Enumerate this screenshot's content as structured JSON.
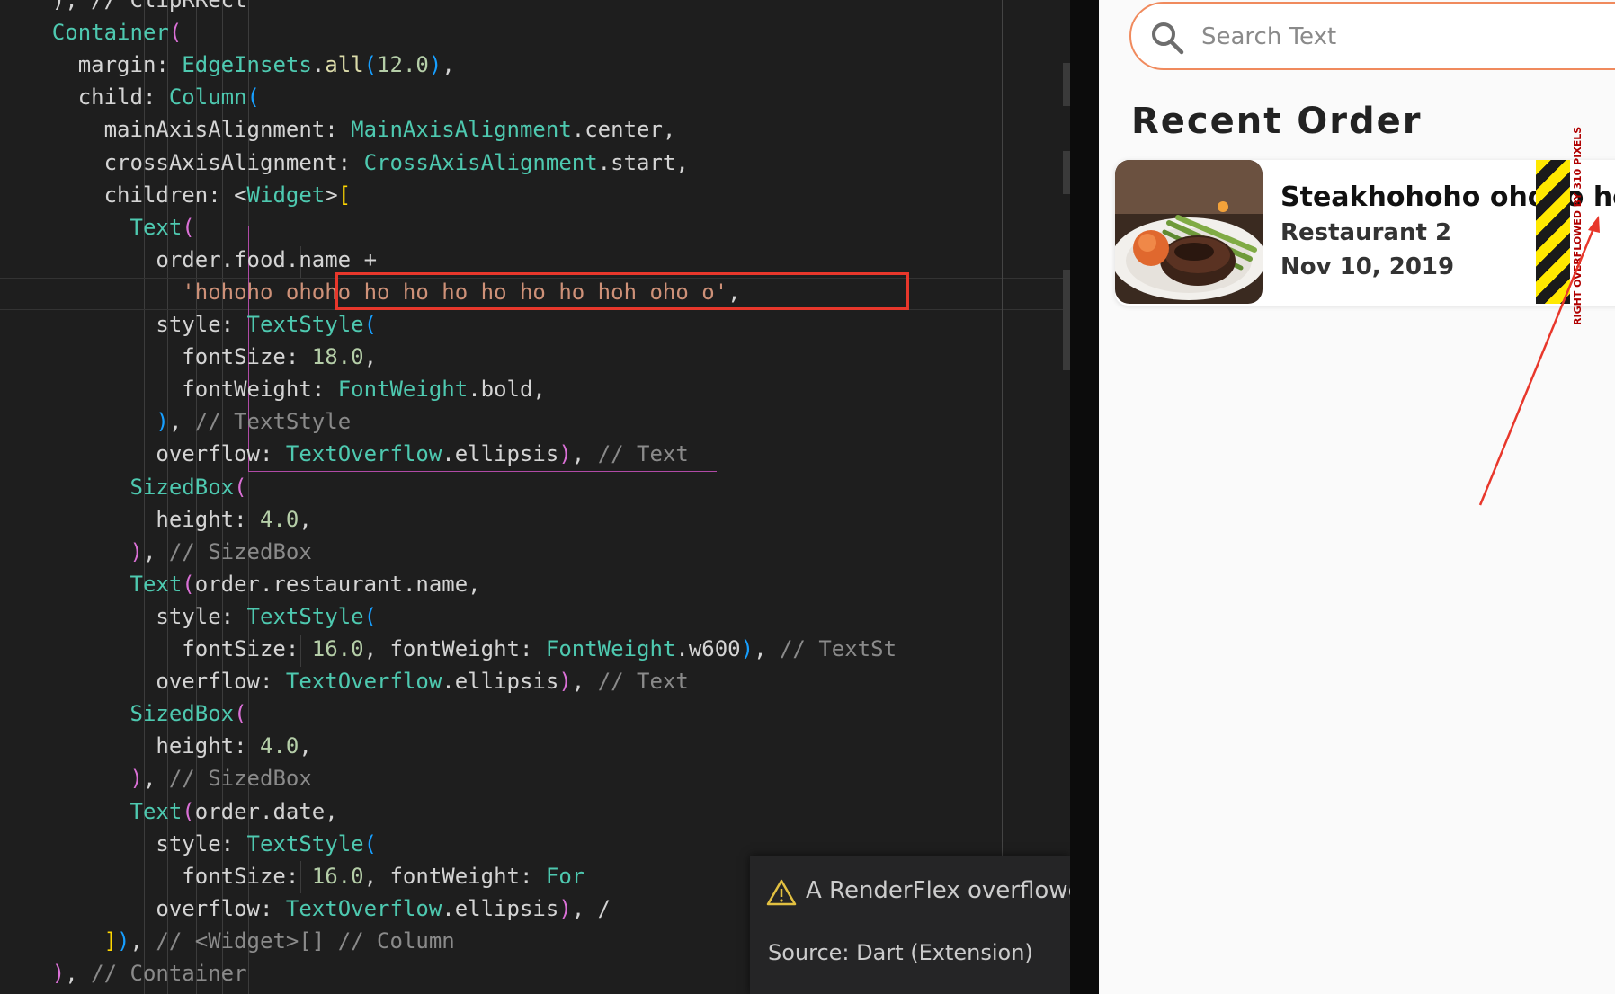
{
  "editor": {
    "lines": [
      [
        {
          "c": "tl",
          "t": "    ), // ClipRRect"
        }
      ],
      [
        {
          "c": "cl",
          "t": "    Container"
        },
        {
          "c": "p1",
          "t": "("
        }
      ],
      [
        {
          "c": "tl",
          "t": "      margin: "
        },
        {
          "c": "cl",
          "t": "EdgeInsets"
        },
        {
          "c": "tl",
          "t": "."
        },
        {
          "c": "fn",
          "t": "all"
        },
        {
          "c": "p3",
          "t": "("
        },
        {
          "c": "num",
          "t": "12.0"
        },
        {
          "c": "p3",
          "t": ")"
        },
        {
          "c": "tl",
          "t": ","
        }
      ],
      [
        {
          "c": "tl",
          "t": "      child: "
        },
        {
          "c": "cl",
          "t": "Column"
        },
        {
          "c": "p3",
          "t": "("
        }
      ],
      [
        {
          "c": "tl",
          "t": "        mainAxisAlignment: "
        },
        {
          "c": "cl",
          "t": "MainAxisAlignment"
        },
        {
          "c": "tl",
          "t": ".center,"
        }
      ],
      [
        {
          "c": "tl",
          "t": "        crossAxisAlignment: "
        },
        {
          "c": "cl",
          "t": "CrossAxisAlignment"
        },
        {
          "c": "tl",
          "t": ".start,"
        }
      ],
      [
        {
          "c": "tl",
          "t": "        children: <"
        },
        {
          "c": "cl",
          "t": "Widget"
        },
        {
          "c": "tl",
          "t": ">"
        },
        {
          "c": "p2",
          "t": "["
        }
      ],
      [
        {
          "c": "cl",
          "t": "          Text"
        },
        {
          "c": "p1",
          "t": "("
        }
      ],
      [
        {
          "c": "tl",
          "t": "            order.food.name +"
        }
      ],
      [
        {
          "c": "str",
          "t": "              'hohoho ohoho ho ho ho ho ho ho hoh oho o'"
        },
        {
          "c": "tl",
          "t": ","
        }
      ],
      [
        {
          "c": "tl",
          "t": "            style: "
        },
        {
          "c": "cl",
          "t": "TextStyle"
        },
        {
          "c": "p3",
          "t": "("
        }
      ],
      [
        {
          "c": "tl",
          "t": "              fontSize: "
        },
        {
          "c": "num",
          "t": "18.0"
        },
        {
          "c": "tl",
          "t": ","
        }
      ],
      [
        {
          "c": "tl",
          "t": "              fontWeight: "
        },
        {
          "c": "cl",
          "t": "FontWeight"
        },
        {
          "c": "tl",
          "t": ".bold,"
        }
      ],
      [
        {
          "c": "p3",
          "t": "            )"
        },
        {
          "c": "tl",
          "t": ", "
        },
        {
          "c": "cm",
          "t": "// TextStyle"
        }
      ],
      [
        {
          "c": "tl",
          "t": "            overflow: "
        },
        {
          "c": "cl",
          "t": "TextOverflow"
        },
        {
          "c": "tl",
          "t": ".ellipsis"
        },
        {
          "c": "p1",
          "t": ")"
        },
        {
          "c": "tl",
          "t": ", "
        },
        {
          "c": "cm",
          "t": "// Text"
        }
      ],
      [
        {
          "c": "cl",
          "t": "          SizedBox"
        },
        {
          "c": "p1",
          "t": "("
        }
      ],
      [
        {
          "c": "tl",
          "t": "            height: "
        },
        {
          "c": "num",
          "t": "4.0"
        },
        {
          "c": "tl",
          "t": ","
        }
      ],
      [
        {
          "c": "p1",
          "t": "          )"
        },
        {
          "c": "tl",
          "t": ", "
        },
        {
          "c": "cm",
          "t": "// SizedBox"
        }
      ],
      [
        {
          "c": "cl",
          "t": "          Text"
        },
        {
          "c": "p1",
          "t": "("
        },
        {
          "c": "tl",
          "t": "order.restaurant.name,"
        }
      ],
      [
        {
          "c": "tl",
          "t": "            style: "
        },
        {
          "c": "cl",
          "t": "TextStyle"
        },
        {
          "c": "p3",
          "t": "("
        }
      ],
      [
        {
          "c": "tl",
          "t": "              fontSize: "
        },
        {
          "c": "num",
          "t": "16.0"
        },
        {
          "c": "tl",
          "t": ", fontWeight: "
        },
        {
          "c": "cl",
          "t": "FontWeight"
        },
        {
          "c": "tl",
          "t": ".w600"
        },
        {
          "c": "p3",
          "t": ")"
        },
        {
          "c": "tl",
          "t": ", "
        },
        {
          "c": "cm",
          "t": "// TextSt"
        }
      ],
      [
        {
          "c": "tl",
          "t": "            overflow: "
        },
        {
          "c": "cl",
          "t": "TextOverflow"
        },
        {
          "c": "tl",
          "t": ".ellipsis"
        },
        {
          "c": "p1",
          "t": ")"
        },
        {
          "c": "tl",
          "t": ", "
        },
        {
          "c": "cm",
          "t": "// Text"
        }
      ],
      [
        {
          "c": "cl",
          "t": "          SizedBox"
        },
        {
          "c": "p1",
          "t": "("
        }
      ],
      [
        {
          "c": "tl",
          "t": "            height: "
        },
        {
          "c": "num",
          "t": "4.0"
        },
        {
          "c": "tl",
          "t": ","
        }
      ],
      [
        {
          "c": "p1",
          "t": "          )"
        },
        {
          "c": "tl",
          "t": ", "
        },
        {
          "c": "cm",
          "t": "// SizedBox"
        }
      ],
      [
        {
          "c": "cl",
          "t": "          Text"
        },
        {
          "c": "p1",
          "t": "("
        },
        {
          "c": "tl",
          "t": "order.date,"
        }
      ],
      [
        {
          "c": "tl",
          "t": "            style: "
        },
        {
          "c": "cl",
          "t": "TextStyle"
        },
        {
          "c": "p3",
          "t": "("
        }
      ],
      [
        {
          "c": "tl",
          "t": "              fontSize: "
        },
        {
          "c": "num",
          "t": "16.0"
        },
        {
          "c": "tl",
          "t": ", fontWeight: "
        },
        {
          "c": "cl",
          "t": "For"
        }
      ],
      [
        {
          "c": "tl",
          "t": "            overflow: "
        },
        {
          "c": "cl",
          "t": "TextOverflow"
        },
        {
          "c": "tl",
          "t": ".ellipsis"
        },
        {
          "c": "p1",
          "t": ")"
        },
        {
          "c": "tl",
          "t": ", /"
        }
      ],
      [
        {
          "c": "p2",
          "t": "        ]"
        },
        {
          "c": "p3",
          "t": ")"
        },
        {
          "c": "tl",
          "t": ", "
        },
        {
          "c": "cm",
          "t": "// <Widget>[] // Column"
        }
      ],
      [
        {
          "c": "p1",
          "t": "    )"
        },
        {
          "c": "tl",
          "t": ", "
        },
        {
          "c": "cm",
          "t": "// Container"
        }
      ]
    ]
  },
  "notification": {
    "message": "A RenderFlex overflowed",
    "source": "Source: Dart (Extension)",
    "icon": "warning-icon"
  },
  "app": {
    "search_placeholder": "Search Text",
    "section_title": "Recent Order",
    "order": {
      "food_name": "Steakhohoho ohoho ho ho",
      "restaurant": "Restaurant 2",
      "date": "Nov 10, 2019"
    },
    "overflow_label": "RIGHT OVERFLOWED BY 310 PIXELS"
  },
  "colors": {
    "accent": "#f08a5d",
    "error": "#e8372b",
    "stripe_yellow": "#ffe800"
  }
}
